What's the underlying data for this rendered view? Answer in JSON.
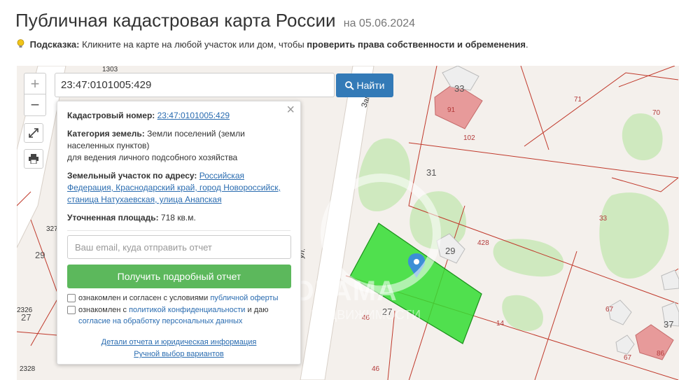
{
  "header": {
    "title": "Публичная кадастровая карта России",
    "date": "на 05.06.2024"
  },
  "hint": {
    "label": "Подсказка:",
    "text": " Кликните на карте на любой участок или дом, чтобы ",
    "emphasis": "проверить права собственности и обременения",
    "end": "."
  },
  "toolbar": {
    "zoom_in": "+",
    "zoom_out": "−",
    "search_value": "23:47:0101005:429",
    "search_button": "Найти"
  },
  "popup": {
    "cadastral_label": "Кадастровый номер:",
    "cadastral_value": "23:47:0101005:429",
    "category_label": "Категория земель:",
    "category_value": " Земли поселений (земли населенных пунктов)",
    "usage": "для ведения личного подсобного хозяйства",
    "address_label": "Земельный участок по адресу:",
    "address_value": "Российская Федерация, Краснодарский край, город Новороссийск, станица Натухаевская, улица Анапская",
    "area_label": "Уточненная площадь:",
    "area_value": " 718 кв.м.",
    "email_placeholder": "Ваш email, куда отправить отчет",
    "report_button": "Получить подробный отчет",
    "consent1_text": "ознакомлен и согласен с условиями ",
    "consent1_link": "публичной оферты",
    "consent2_text": "ознакомлен с ",
    "consent2_link": "политикой конфиденциальности",
    "consent2_mid": " и даю ",
    "consent2_link2": "согласие на обработку персональных данных",
    "link_details": "Детали отчета и юридическая информация",
    "link_manual": "Ручной выбор вариантов"
  },
  "map": {
    "house_numbers": [
      "33",
      "31",
      "29",
      "27",
      "37",
      "29",
      "27",
      "33"
    ],
    "plot_numbers": [
      "91",
      "102",
      "71",
      "70",
      "428",
      "33",
      "67",
      "14",
      "46",
      "67",
      "86",
      "46",
      "2326",
      "2328",
      "327",
      "1303"
    ],
    "streets": [
      "Западная",
      "ул."
    ],
    "watermark": "ПАНОРАМА",
    "watermark_sub": "НЕДВИЖИМОСТИ"
  },
  "colors": {
    "selected_parcel": "#33dd33",
    "building": "#e79a9a",
    "boundary": "#c0392b",
    "search_button": "#337ab7",
    "report_button": "#5cb85c"
  }
}
